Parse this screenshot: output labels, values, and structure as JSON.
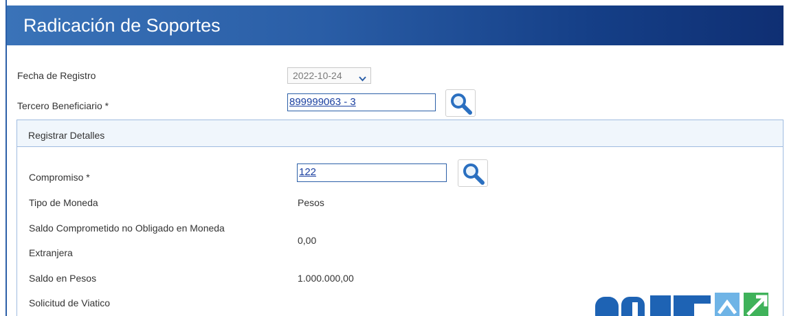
{
  "window": {
    "title": "Radicación de Soportes"
  },
  "form": {
    "fecha_registro": {
      "label": "Fecha de Registro",
      "value": "2022-10-24"
    },
    "tercero_beneficiario": {
      "label": "Tercero Beneficiario *",
      "value": "899999063 - 3"
    }
  },
  "detalles": {
    "title": "Registrar Detalles",
    "compromiso": {
      "label": "Compromiso *",
      "value": "122"
    },
    "tipo_moneda": {
      "label": "Tipo de Moneda",
      "value": "Pesos"
    },
    "saldo_extranjera": {
      "label_line1": "Saldo Comprometido no Obligado en Moneda",
      "label_line2": "Extranjera",
      "value": "0,00"
    },
    "saldo_pesos": {
      "label": "Saldo en Pesos",
      "value": "1.000.000,00"
    },
    "solicitud_viatico": {
      "label": "Solicitud de Viatico"
    }
  },
  "icons": {
    "search": "search-icon",
    "dropdown": "chevron-down-icon"
  },
  "colors": {
    "title_bar_start": "#3a73b8",
    "title_bar_end": "#0f2f73",
    "input_border": "#2a5ea7",
    "panel_border": "#9fbbe0",
    "link_text": "#1a3fa0"
  }
}
